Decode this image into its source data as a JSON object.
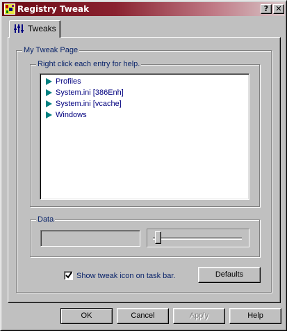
{
  "window": {
    "title": "Registry Tweak",
    "help_button": "?",
    "close_button": "✕"
  },
  "tab": {
    "label": "Tweaks"
  },
  "page": {
    "group_title": "My Tweak Page",
    "list_group_title": "Right click each entry for help.",
    "list_items": [
      "Profiles",
      "System.ini [386Enh]",
      "System.ini [vcache]",
      "Windows"
    ],
    "data_group_title": "Data",
    "data_value": "",
    "slider_position": 0,
    "checkbox_checked": true,
    "checkbox_label": "Show tweak icon on task bar.",
    "defaults_button": "Defaults"
  },
  "footer": {
    "ok": "OK",
    "cancel": "Cancel",
    "apply": "Apply",
    "help": "Help"
  },
  "colors": {
    "title_bar_start": "#6b0a14",
    "title_bar_end": "#d8c7c9",
    "group_label": "#0a246a",
    "list_arrow": "#008080",
    "list_text": "#00007f"
  }
}
